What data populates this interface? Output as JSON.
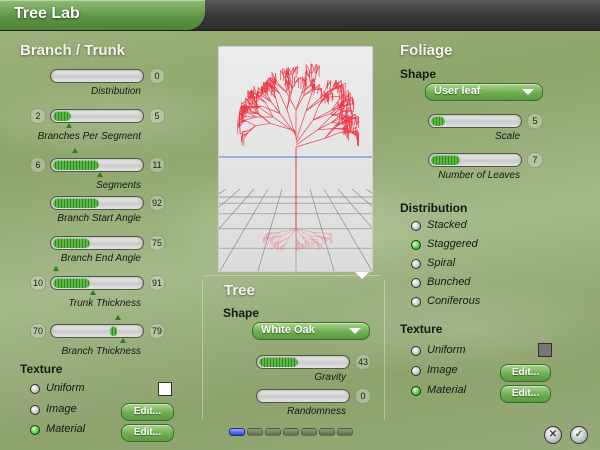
{
  "window": {
    "title": "Tree Lab"
  },
  "branch": {
    "title": "Branch / Trunk",
    "sliders": [
      {
        "label": "Distribution",
        "min": "",
        "max": "0",
        "fill": 0.0
      },
      {
        "label": "Branches Per Segment",
        "min": "2",
        "max": "5",
        "fill": 0.2
      },
      {
        "label": "Segments",
        "min": "6",
        "max": "11",
        "fill": 0.5
      },
      {
        "label": "Branch Start Angle",
        "min": "",
        "max": "92",
        "fill": 0.5
      },
      {
        "label": "Branch End Angle",
        "min": "",
        "max": "75",
        "fill": 0.4
      },
      {
        "label": "Trunk Thickness",
        "min": "10",
        "max": "91",
        "fill": 0.4
      },
      {
        "label": "Branch Thickness",
        "min": "70",
        "max": "79",
        "fill": 0.72
      }
    ],
    "texture": {
      "title": "Texture",
      "options": [
        "Uniform",
        "Image",
        "Material"
      ],
      "selected": "Material",
      "edit_label": "Edit...",
      "swatch_color": "#ffffff"
    }
  },
  "tree": {
    "title": "Tree",
    "shape_label": "Shape",
    "shape_value": "White Oak",
    "sliders": [
      {
        "label": "Gravity",
        "min": "",
        "max": "43",
        "fill": 0.42
      },
      {
        "label": "Randomness",
        "min": "",
        "max": "0",
        "fill": 0.0
      }
    ]
  },
  "foliage": {
    "title": "Foliage",
    "shape_label": "Shape",
    "shape_value": "User leaf",
    "sliders": [
      {
        "label": "Scale",
        "min": "",
        "max": "5",
        "fill": 0.15
      },
      {
        "label": "Number of Leaves",
        "min": "",
        "max": "7",
        "fill": 0.32
      }
    ],
    "distribution": {
      "title": "Distribution",
      "options": [
        "Stacked",
        "Staggered",
        "Spiral",
        "Bunched",
        "Coniferous"
      ],
      "selected": "Staggered"
    },
    "texture": {
      "title": "Texture",
      "options": [
        "Uniform",
        "Image",
        "Material"
      ],
      "selected": "Material",
      "edit_label": "Edit...",
      "swatch_color": "#777777"
    }
  },
  "footer": {
    "page_count": 7,
    "active_page": 1,
    "cancel_glyph": "✕",
    "ok_glyph": "✓"
  },
  "colors": {
    "accent_green": "#5fb54a",
    "title_green": "#5f9545",
    "tree_red": "#ee3b4b",
    "horizon_blue": "#4f7fd9"
  }
}
